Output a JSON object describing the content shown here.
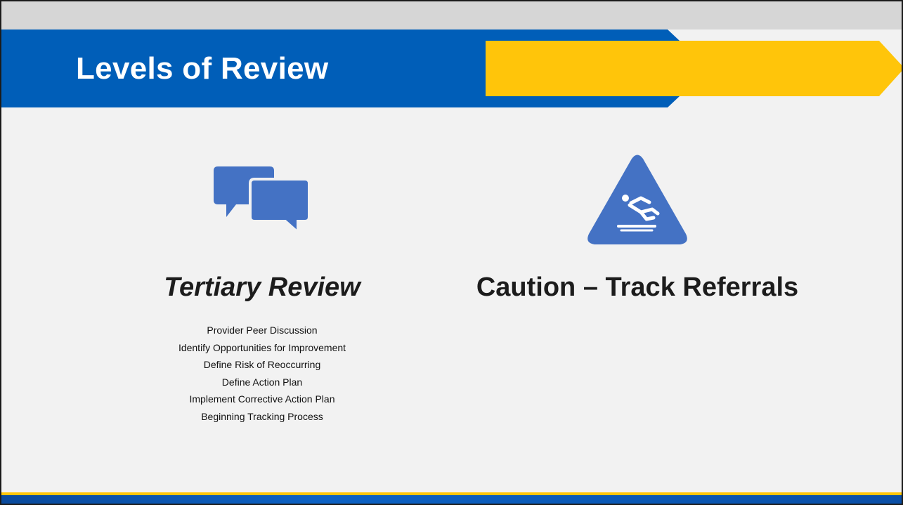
{
  "slide": {
    "title": "Levels of Review"
  },
  "left_column": {
    "icon": "speech-bubbles-icon",
    "heading": "Tertiary Review",
    "items": [
      "Provider Peer Discussion",
      "Identify Opportunities for Improvement",
      "Define Risk of Reoccurring",
      "Define Action Plan",
      "Implement Corrective Action Plan",
      "Beginning Tracking Process"
    ]
  },
  "right_column": {
    "icon": "caution-slippery-floor-icon",
    "heading": "Caution – Track Referrals"
  },
  "colors": {
    "brand_blue": "#005eb8",
    "accent_gold": "#ffc50a",
    "icon_blue": "#4472c4",
    "background": "#f2f2f2"
  }
}
